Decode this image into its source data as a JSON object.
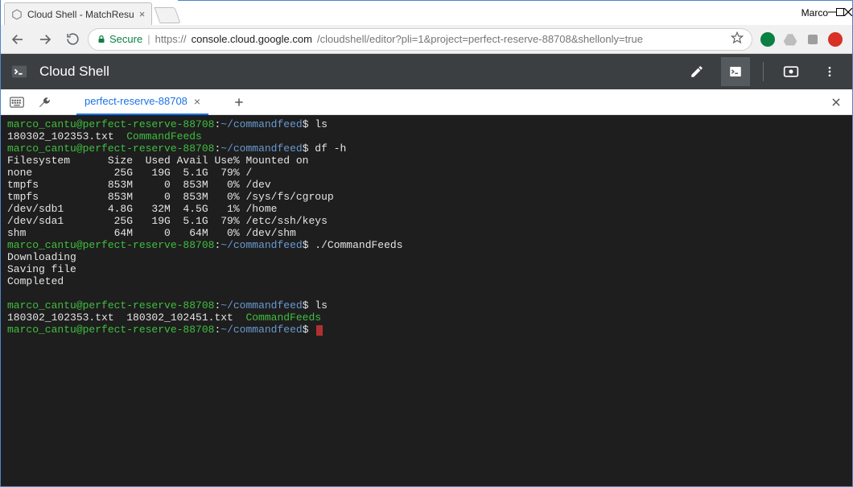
{
  "window": {
    "profile": "Marco"
  },
  "browser": {
    "tab_title": "Cloud Shell - MatchResu",
    "secure_label": "Secure",
    "url_scheme": "https://",
    "url_host": "console.cloud.google.com",
    "url_path": "/cloudshell/editor?pli=1&project=perfect-reserve-88708&shellonly=true"
  },
  "app": {
    "title": "Cloud Shell"
  },
  "shell_tab": {
    "label": "perfect-reserve-88708"
  },
  "terminal": {
    "prompt_user": "marco_cantu@perfect-reserve-88708",
    "prompt_path": "~/commandfeed",
    "prompt_symbol": "$",
    "lines": [
      {
        "type": "prompt",
        "cmd": "ls"
      },
      {
        "type": "ls1",
        "files": [
          "180302_102353.txt"
        ],
        "dirs": [
          "CommandFeeds"
        ]
      },
      {
        "type": "prompt",
        "cmd": "df -h"
      },
      {
        "type": "plain",
        "text": "Filesystem      Size  Used Avail Use% Mounted on"
      },
      {
        "type": "plain",
        "text": "none             25G   19G  5.1G  79% /"
      },
      {
        "type": "plain",
        "text": "tmpfs           853M     0  853M   0% /dev"
      },
      {
        "type": "plain",
        "text": "tmpfs           853M     0  853M   0% /sys/fs/cgroup"
      },
      {
        "type": "plain",
        "text": "/dev/sdb1       4.8G   32M  4.5G   1% /home"
      },
      {
        "type": "plain",
        "text": "/dev/sda1        25G   19G  5.1G  79% /etc/ssh/keys"
      },
      {
        "type": "plain",
        "text": "shm              64M     0   64M   0% /dev/shm"
      },
      {
        "type": "prompt",
        "cmd": "./CommandFeeds"
      },
      {
        "type": "plain",
        "text": "Downloading"
      },
      {
        "type": "plain",
        "text": "Saving file"
      },
      {
        "type": "plain",
        "text": "Completed"
      },
      {
        "type": "blank"
      },
      {
        "type": "prompt",
        "cmd": "ls"
      },
      {
        "type": "ls2",
        "files": [
          "180302_102353.txt",
          "180302_102451.txt"
        ],
        "dirs": [
          "CommandFeeds"
        ]
      },
      {
        "type": "prompt_cursor"
      }
    ]
  }
}
